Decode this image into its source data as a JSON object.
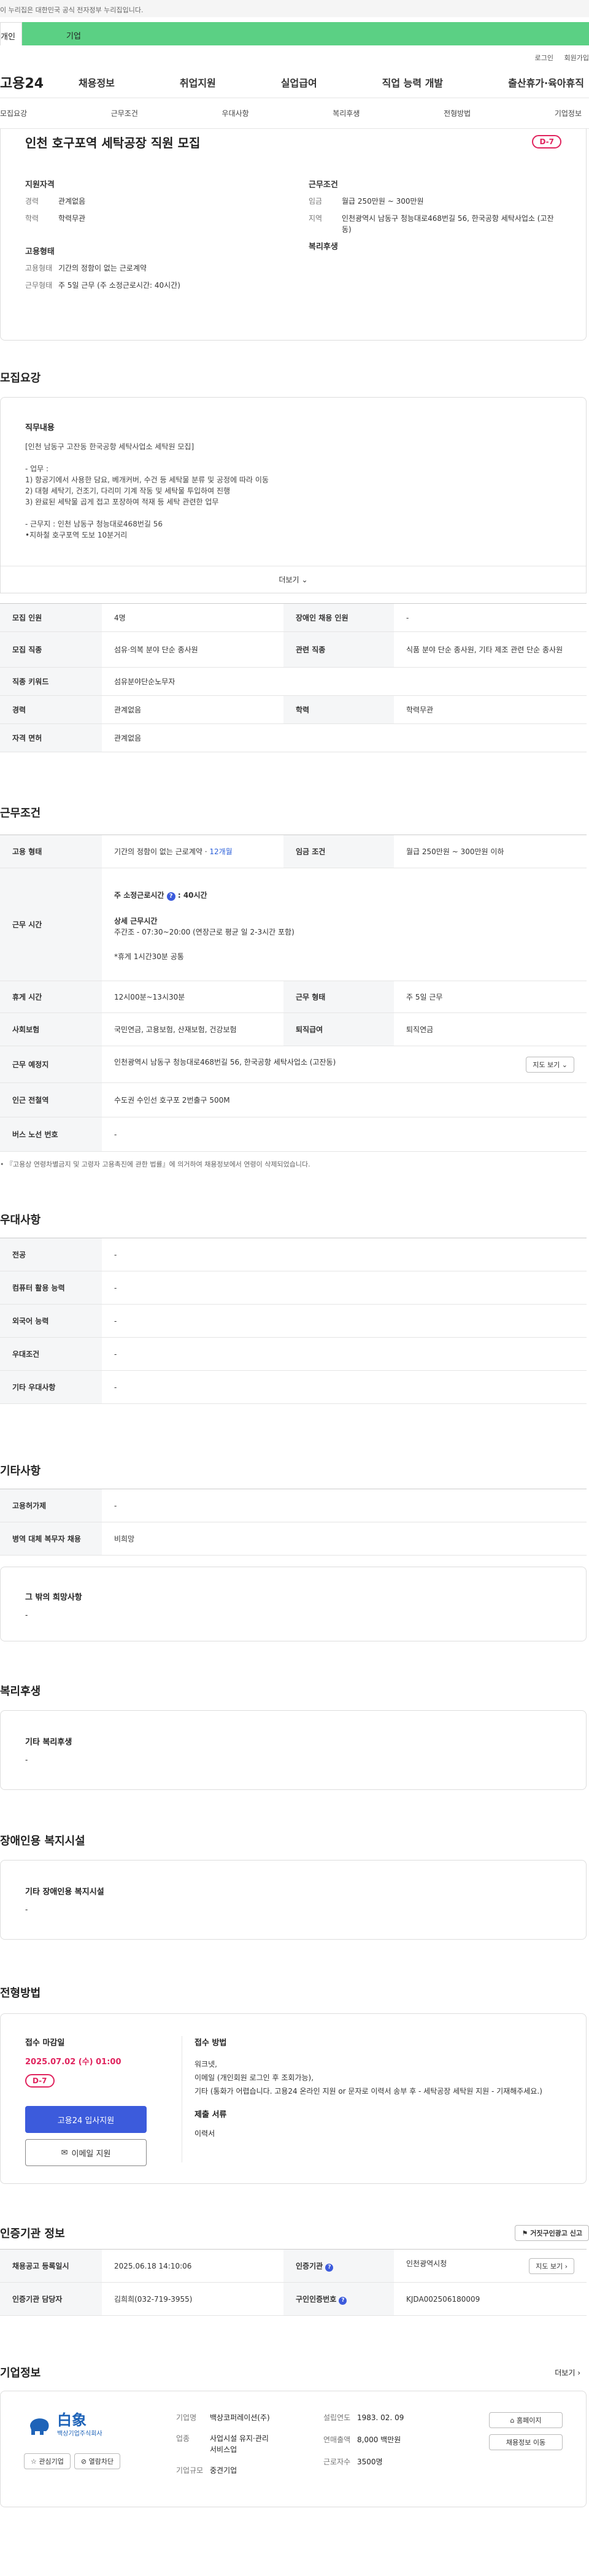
{
  "gov_banner": "이 누리집은 대한민국 공식 전자정부 누리집입니다.",
  "top_tabs": [
    "개인",
    "기업"
  ],
  "util_links": [
    "로그인",
    "회원가입"
  ],
  "logo": "고용24",
  "gnb": [
    "채용정보",
    "취업지원",
    "실업급여",
    "직업 능력 개발",
    "출산휴가·육아휴직"
  ],
  "tabs": [
    "모집요강",
    "근무조건",
    "우대사항",
    "복리후생",
    "전형방법",
    "기업정보"
  ],
  "summary": {
    "title": "인천 호구포역 세탁공장 직원 모집",
    "dday": "D-7",
    "qual_heading": "지원자격",
    "qual": [
      {
        "k": "경력",
        "v": "관계없음"
      },
      {
        "k": "학력",
        "v": "학력무관"
      }
    ],
    "cond_heading": "근무조건",
    "cond": [
      {
        "k": "임금",
        "v": "월급 250만원 ~ 300만원"
      },
      {
        "k": "지역",
        "v": "인천광역시 남동구 청능대로468번길 56, 한국공항 세탁사업소 (고잔동)"
      }
    ],
    "emp_heading": "고용형태",
    "emp": [
      {
        "k": "고용형태",
        "v": "기간의 정함이 없는 근로계약"
      },
      {
        "k": "근무형태",
        "v": "주 5일 근무 (주 소정근로시간: 40시간)"
      }
    ],
    "welfare_heading": "복리후생"
  },
  "recruit": {
    "title": "모집요강",
    "job_content_heading": "직무내용",
    "job_content_lines": [
      "[인천 남동구 고잔동 한국공항 세탁사업소 세탁원 모집]",
      "",
      "- 업무 :",
      "1) 항공기에서 사용한 담요, 베개커버, 수건 등 세탁물 분류 및 공정에 따라 이동",
      "2) 대형 세탁기, 건조기, 다리미 기계 작동 및 세탁물 투입하여 진행",
      "3) 완료된 세탁물 곱게 접고 포장하여 적재 등 세탁 관련한 업무",
      "",
      "- 근무지 : 인천 남동구 청능대로468번길 56",
      "•지하철 호구포역 도보 10분거리"
    ],
    "more": "더보기",
    "rows": [
      [
        "모집 인원",
        "4명",
        "장애인 채용 인원",
        "-"
      ],
      [
        "모집 직종",
        "섬유·의복 분야 단순 종사원",
        "관련 직종",
        "식품 분야 단순 종사원, 기타 제조 관련 단순 종사원"
      ],
      [
        "직종 키워드",
        "섬유분야단순노무자"
      ],
      [
        "경력",
        "관계없음",
        "학력",
        "학력무관"
      ],
      [
        "자격 면허",
        "관계없음"
      ]
    ]
  },
  "work": {
    "title": "근무조건",
    "emp_type_label": "고용 형태",
    "emp_type": "기간의 정함이 없는 근로계약 · ",
    "emp_type_link": "12개월",
    "wage_label": "임금 조건",
    "wage": "월급 250만원 ~ 300만원 이하",
    "hours_label": "근무 시간",
    "hours_main": "주 소정근로시간",
    "hours_value": ": 40시간",
    "hours_detail_title": "상세 근무시간",
    "hours_detail": "주간조 - 07:30~20:00 (연장근로 평균 일 2-3시간 포함)",
    "hours_break": "*휴게 1시간30분 공통",
    "break_label": "휴게 시간",
    "break": "12시00분~13시30분",
    "form_label": "근무 형태",
    "form": "주 5일 근무",
    "insurance_label": "사회보험",
    "insurance": "국민연금, 고용보험, 산재보험, 건강보험",
    "severance_label": "퇴직급여",
    "severance": "퇴직연금",
    "place_label": "근무 예정지",
    "place": "인천광역시 남동구 청능대로468번길 56, 한국공항 세탁사업소 (고잔동)",
    "map_btn": "지도 보기",
    "subway_label": "인근 전철역",
    "subway": "수도권 수인선 호구포 2번출구 500M",
    "bus_label": "버스 노선 번호",
    "bus": "-",
    "footnote": "『고용상 연령차별금지 및 고령자 고용촉진에 관한 법률』에 의거하여 채용정보에서 연령이 삭제되었습니다."
  },
  "pref": {
    "title": "우대사항",
    "rows": [
      [
        "전공",
        "-"
      ],
      [
        "컴퓨터 활용 능력",
        "-"
      ],
      [
        "외국어 능력",
        "-"
      ],
      [
        "우대조건",
        "-"
      ],
      [
        "기타 우대사항",
        "-"
      ]
    ]
  },
  "etc": {
    "title": "기타사항",
    "rows": [
      [
        "고용허가제",
        "-"
      ],
      [
        "병역 대체 복무자 채용",
        "비희망"
      ]
    ],
    "other_heading": "그 밖의 희망사항",
    "other": "-"
  },
  "welfare": {
    "title": "복리후생",
    "heading": "기타 복리후생",
    "value": "-"
  },
  "disabled": {
    "title": "장애인용 복지시설",
    "heading": "기타 장애인용 복지시설",
    "value": "-"
  },
  "selection": {
    "title": "전형방법",
    "deadline_label": "접수 마감일",
    "deadline": "2025.07.02 (수) 01:00",
    "dday": "D-7",
    "apply_btn": "고용24 입사지원",
    "email_btn": "이메일 지원",
    "method_label": "접수 방법",
    "method_lines": [
      "워크넷,",
      "이메일 (개인회원 로그인 후 조회가능),",
      "기타 (통화가 어렵습니다. 고용24 온라인 지원 or 문자로 이력서 송부 후 - 세탁공장 세탁원 지원 - 기재해주세요.)"
    ],
    "docs_label": "제출 서류",
    "docs": "이력서"
  },
  "cert": {
    "title": "인증기관 정보",
    "report_btn": "거짓구인광고 신고",
    "reg_label": "채용공고 등록일시",
    "reg": "2025.06.18 14:10:06",
    "org_label": "인증기관",
    "org": "인천광역시청",
    "map_btn": "지도 보기",
    "manager_label": "인증기관 담당자",
    "manager": "김희희(032-719-3955)",
    "num_label": "구인인증번호",
    "num": "KJDA002506180009"
  },
  "company": {
    "title": "기업정보",
    "more": "더보기",
    "logo_text": "백상기업주식회사",
    "logo_mark": "白象",
    "fav_btn": "관심기업",
    "hide_btn": "열람차단",
    "name_label": "기업명",
    "name": "백상코퍼레이션(주)",
    "biz_label": "업종",
    "biz": "사업시설 유지·관리 서비스업",
    "size_label": "기업규모",
    "size": "중견기업",
    "est_label": "설립연도",
    "est": "1983. 02. 09",
    "sales_label": "연매출액",
    "sales": "8,000 백만원",
    "emp_label": "근로자수",
    "emp": "3500명",
    "home_btn": "홈페이지",
    "jobs_btn": "채용정보 이동"
  },
  "colors": {
    "accent": "#5bd084",
    "primary": "#3c5bdc",
    "dday": "#e0245e"
  }
}
